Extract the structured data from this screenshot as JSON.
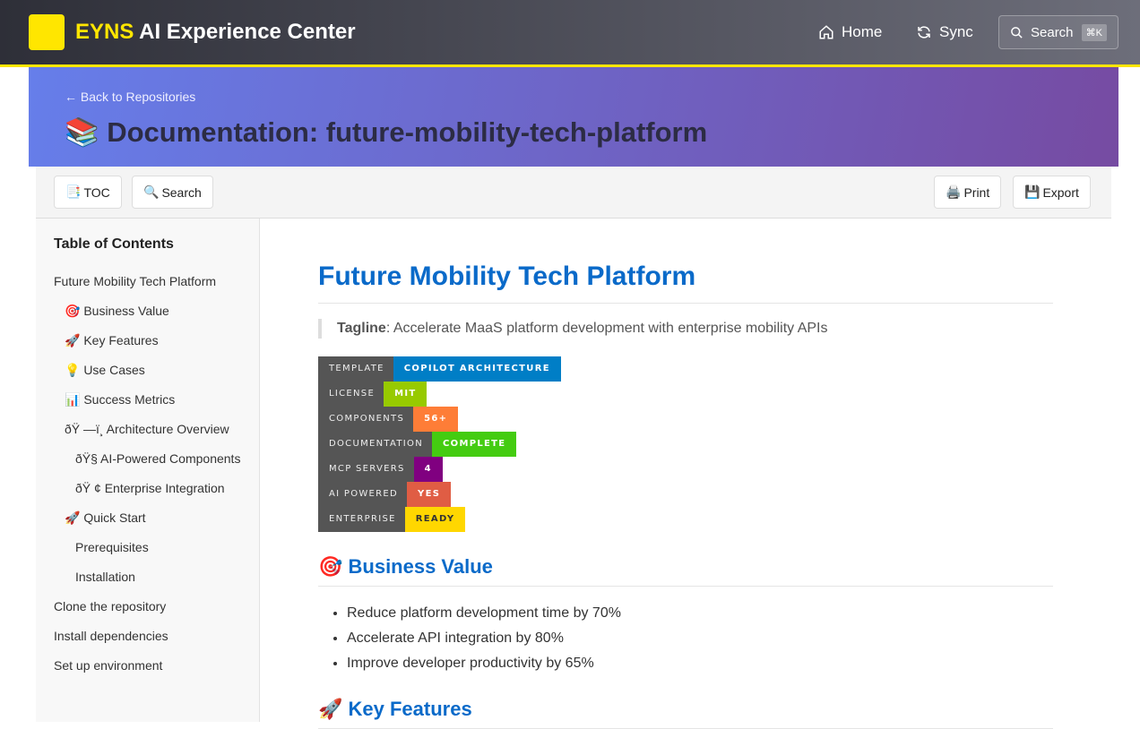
{
  "header": {
    "brand_accent": "EYNS",
    "brand_rest": "AI Experience Center",
    "nav": [
      {
        "label": "Home",
        "icon": "home-icon"
      },
      {
        "label": "Sync",
        "icon": "sync-icon"
      }
    ],
    "search_label": "Search",
    "search_shortcut": "⌘K"
  },
  "banner": {
    "back_link": "← Back to Repositories",
    "title_icon": "📚",
    "title": "Documentation: future-mobility-tech-platform"
  },
  "toolbar": {
    "toc": {
      "icon": "📑",
      "label": "TOC"
    },
    "search": {
      "icon": "🔍",
      "label": "Search"
    },
    "print": {
      "icon": "🖨️",
      "label": "Print"
    },
    "export": {
      "icon": "💾",
      "label": "Export"
    }
  },
  "sidebar": {
    "title": "Table of Contents",
    "items": [
      {
        "label": "Future Mobility Tech Platform",
        "level": 0
      },
      {
        "label": "🎯 Business Value",
        "level": 1
      },
      {
        "label": "🚀 Key Features",
        "level": 1
      },
      {
        "label": "💡 Use Cases",
        "level": 1
      },
      {
        "label": "📊 Success Metrics",
        "level": 1
      },
      {
        "label": "ðŸ —ï¸  Architecture Overview",
        "level": 1
      },
      {
        "label": "ðŸ§  AI-Powered Components",
        "level": 2
      },
      {
        "label": "ðŸ ¢ Enterprise Integration",
        "level": 2
      },
      {
        "label": "🚀 Quick Start",
        "level": 1
      },
      {
        "label": "Prerequisites",
        "level": 2
      },
      {
        "label": "Installation",
        "level": 2
      },
      {
        "label": "Clone the repository",
        "level": 0
      },
      {
        "label": "Install dependencies",
        "level": 0
      },
      {
        "label": "Set up environment",
        "level": 0
      }
    ]
  },
  "main": {
    "title": "Future Mobility Tech Platform",
    "tagline_label": "Tagline",
    "tagline_text": ": Accelerate MaaS platform development with enterprise mobility APIs",
    "badges": [
      {
        "key": "TEMPLATE",
        "value": "COPILOT ARCHITECTURE",
        "color": "#007ec6",
        "dark": false
      },
      {
        "key": "LICENSE",
        "value": "MIT",
        "color": "#97ca00",
        "dark": false
      },
      {
        "key": "COMPONENTS",
        "value": "56+",
        "color": "#fe7d37",
        "dark": false
      },
      {
        "key": "DOCUMENTATION",
        "value": "COMPLETE",
        "color": "#4c1",
        "dark": false
      },
      {
        "key": "MCP SERVERS",
        "value": "4",
        "color": "#800080",
        "dark": false
      },
      {
        "key": "AI POWERED",
        "value": "YES",
        "color": "#e05d44",
        "dark": false
      },
      {
        "key": "ENTERPRISE",
        "value": "READY",
        "color": "#ffd700",
        "dark": true
      }
    ],
    "business_value": {
      "title": "🎯 Business Value",
      "items": [
        "Reduce platform development time by 70%",
        "Accelerate API integration by 80%",
        "Improve developer productivity by 65%"
      ]
    },
    "key_features": {
      "title": "🚀 Key Features"
    }
  }
}
